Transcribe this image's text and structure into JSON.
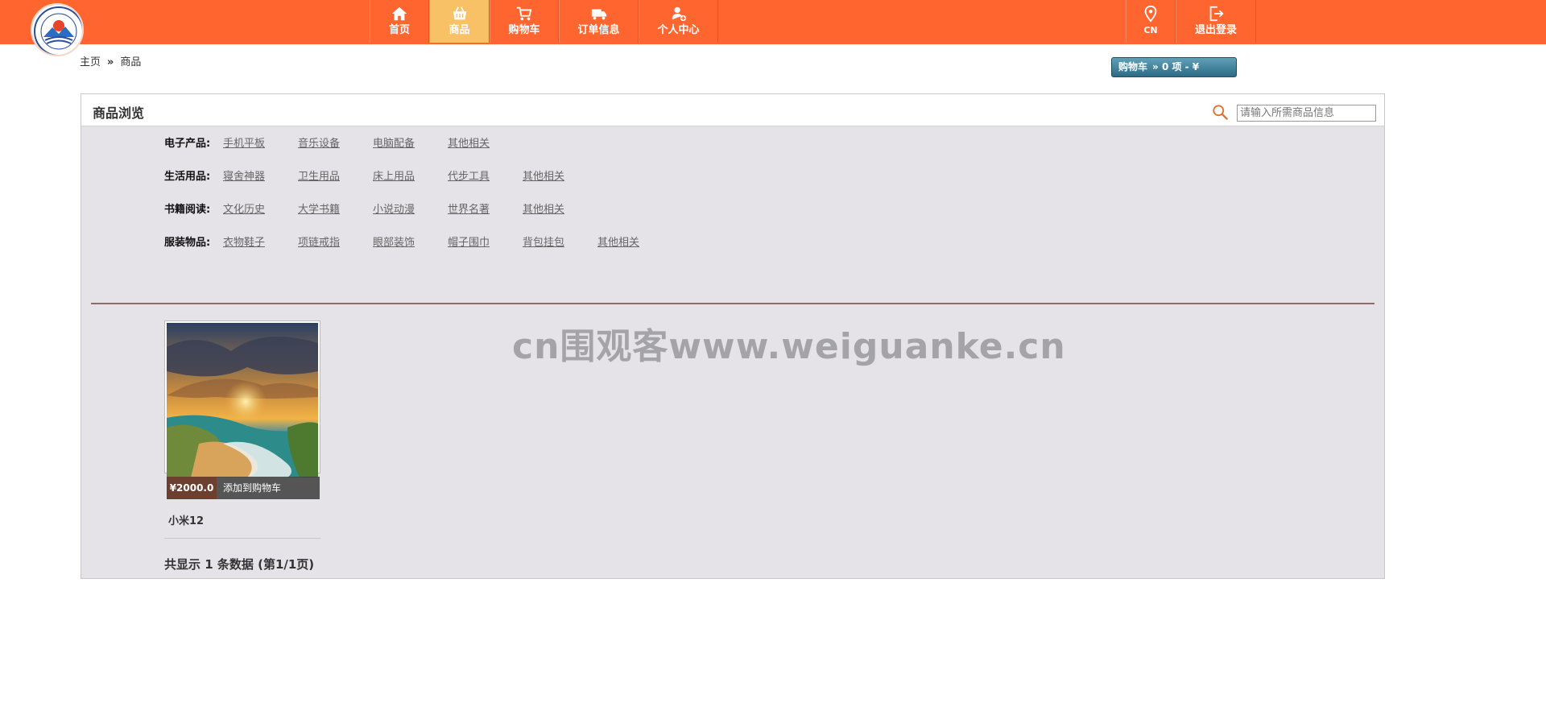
{
  "header": {
    "nav": [
      {
        "label": "首页",
        "icon": "home-icon"
      },
      {
        "label": "商品",
        "icon": "basket-icon",
        "active": true
      },
      {
        "label": "购物车",
        "icon": "cart-icon"
      },
      {
        "label": "订单信息",
        "icon": "truck-icon"
      },
      {
        "label": "个人中心",
        "icon": "user-add-icon"
      }
    ],
    "right": [
      {
        "label": "CN",
        "icon": "location-icon"
      },
      {
        "label": "退出登录",
        "icon": "logout-icon"
      }
    ],
    "colors": {
      "bar": "#ff652f",
      "active": "#f9c165"
    }
  },
  "breadcrumb": {
    "home": "主页",
    "sep": "»",
    "current": "商品"
  },
  "cart_summary": {
    "label": "购物车",
    "count_text": "» 0 项 - ¥"
  },
  "panel": {
    "title": "商品浏览",
    "search_placeholder": "请输入所需商品信息"
  },
  "categories": [
    {
      "label": "电子产品:",
      "items": [
        "手机平板",
        "音乐设备",
        "电脑配备",
        "其他相关"
      ]
    },
    {
      "label": "生活用品:",
      "items": [
        "寝舍神器",
        "卫生用品",
        "床上用品",
        "代步工具",
        "其他相关"
      ]
    },
    {
      "label": "书籍阅读:",
      "items": [
        "文化历史",
        "大学书籍",
        "小说动漫",
        "世界名著",
        "其他相关"
      ]
    },
    {
      "label": "服装物品:",
      "items": [
        "衣物鞋子",
        "项链戒指",
        "眼部装饰",
        "帽子围巾",
        "背包挂包",
        "其他相关"
      ]
    }
  ],
  "product": {
    "price": "¥2000.0",
    "add_to_cart": "添加到购物车",
    "name": "小米12"
  },
  "pagination": {
    "text": "共显示 1 条数据 (第1/1页)"
  },
  "watermark": "cn围观客www.weiguanke.cn"
}
